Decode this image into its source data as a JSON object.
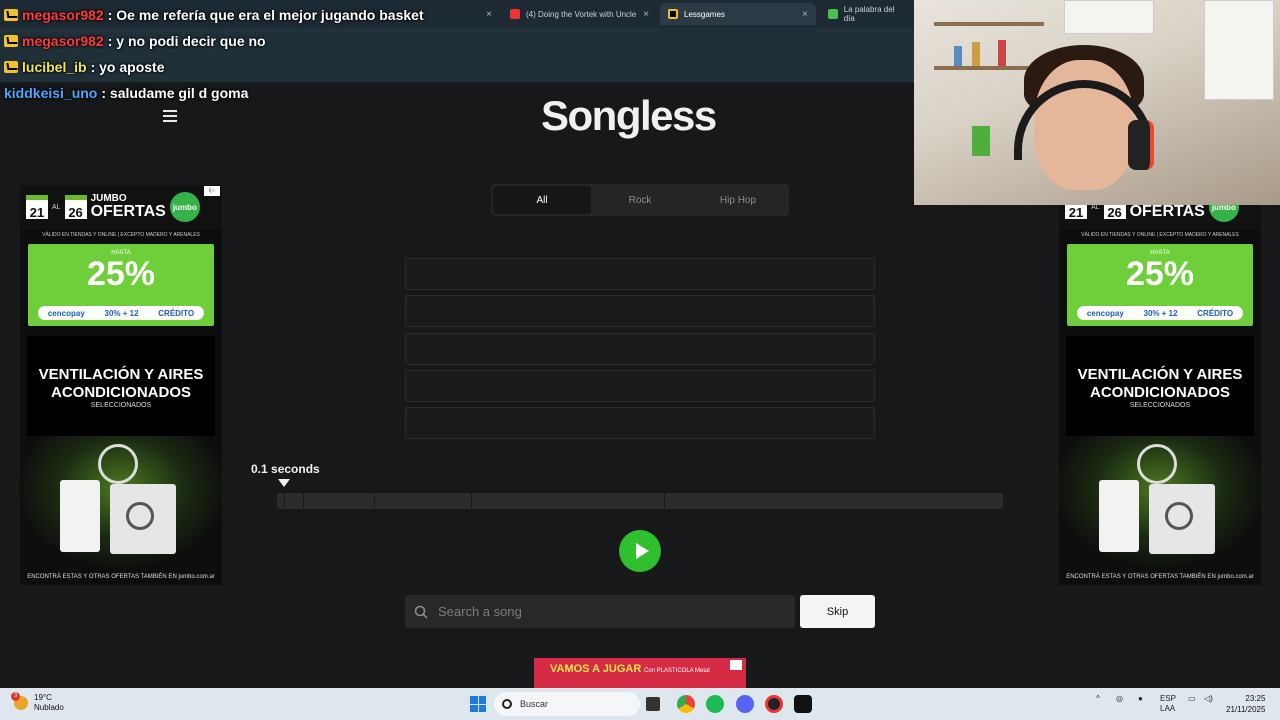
{
  "browser": {
    "tabs": [
      {
        "label": "",
        "active": false
      },
      {
        "label": "(4) Doing the Vortek with Uncle",
        "active": false
      },
      {
        "label": "Lessgames",
        "active": true
      },
      {
        "label": "La palabra del día",
        "active": false
      }
    ]
  },
  "chat": [
    {
      "user": "megasor982",
      "user_color": "#ff3a3a",
      "message": ": Oe me refería que era el mejor jugando basket"
    },
    {
      "user": "megasor982",
      "user_color": "#ff3a3a",
      "message": ": y no podi decir que no"
    },
    {
      "user": "lucibel_ib",
      "user_color": "#f0e45a",
      "message": ": yo aposte"
    },
    {
      "user": "kiddkeisi_uno",
      "user_color": "#4aa8ff",
      "message": ": saludame gil d goma"
    }
  ],
  "app": {
    "logo": "Songless",
    "genre_tabs": [
      {
        "label": "All",
        "active": true
      },
      {
        "label": "Rock",
        "active": false
      },
      {
        "label": "Hip Hop",
        "active": false
      }
    ],
    "guess_slots": [
      "",
      "",
      "",
      "",
      ""
    ],
    "elapsed_label": "0.1 seconds",
    "search": {
      "placeholder": "Search a song"
    },
    "skip_label": "Skip",
    "accent_color": "#2fbf2f"
  },
  "ads": {
    "side": {
      "date_start": "21",
      "date_end": "26",
      "brand_top": "JUMBO",
      "brand_main": "OFERTAS",
      "logo_text": "jumbo",
      "valid_text": "VÁLIDO EN TIENDAS Y ONLINE | EXCEPTO MADERO Y ARENALES",
      "hasta": "HASTA",
      "discount": "25%",
      "payment": "cencopay",
      "payment_extra": "30% + 12",
      "payment_credit": "CRÉDITO",
      "headline": "VENTILACIÓN Y AIRES ACONDICIONADOS",
      "sub": "SELECCIONADOS",
      "footer": "ENCONTRÁ ESTAS Y OTRAS OFERTAS TAMBIÉN EN jumbo.com.ar"
    },
    "banner": {
      "title": "VAMOS A JUGAR",
      "sub": "Con PLASTICOLA Metal"
    }
  },
  "taskbar": {
    "weather_temp": "19°C",
    "weather_desc": "Nublado",
    "weather_badge": "3",
    "search_label": "Buscar",
    "lang_top": "ESP",
    "lang_bottom": "LAA",
    "time": "23:25",
    "date": "21/11/2025"
  }
}
